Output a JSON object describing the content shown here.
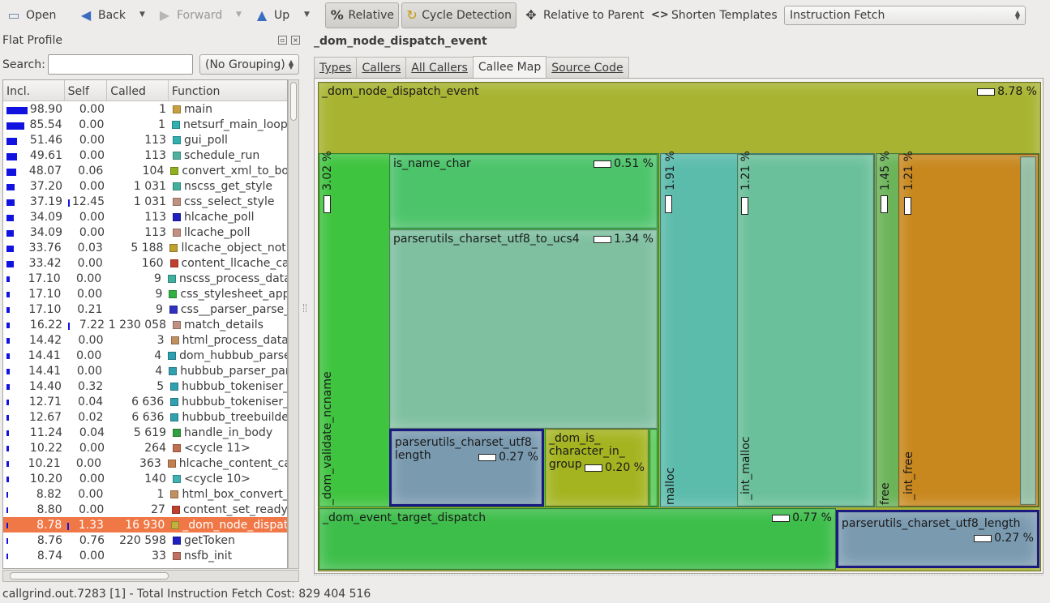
{
  "toolbar": {
    "open": "Open",
    "back": "Back",
    "forward": "Forward",
    "up": "Up",
    "relative": "Relative",
    "cycle": "Cycle Detection",
    "relparent": "Relative to Parent",
    "shorten": "Shorten Templates",
    "eventtype": "Instruction Fetch",
    "icons": {
      "open": "folder-icon",
      "back": "arrow-left-icon",
      "forward": "arrow-right-icon",
      "up": "arrow-up-icon",
      "relative": "percent-icon",
      "cycle": "cycle-icon",
      "relparent": "move-icon",
      "shorten": "angle-brackets-icon"
    }
  },
  "flat": {
    "title": "Flat Profile",
    "search_label": "Search:",
    "search_value": "",
    "grouping": "(No Grouping)",
    "columns": [
      "Incl.",
      "Self",
      "Called",
      "Function"
    ],
    "rows": [
      {
        "incl": "98.90",
        "self": "0.00",
        "called": "1",
        "fn": "main",
        "color": "#c8a040"
      },
      {
        "incl": "85.54",
        "self": "0.00",
        "called": "1",
        "fn": "netsurf_main_loop",
        "color": "#30b0b0"
      },
      {
        "incl": "51.46",
        "self": "0.00",
        "called": "113",
        "fn": "gui_poll",
        "color": "#30b0b0"
      },
      {
        "incl": "49.61",
        "self": "0.00",
        "called": "113",
        "fn": "schedule_run",
        "color": "#50b0a0"
      },
      {
        "incl": "48.07",
        "self": "0.06",
        "called": "104",
        "fn": "convert_xml_to_bo",
        "color": "#90b020"
      },
      {
        "incl": "37.20",
        "self": "0.00",
        "called": "1 031",
        "fn": "nscss_get_style",
        "color": "#40b0a0"
      },
      {
        "incl": "37.19",
        "self": "12.45",
        "called": "1 031",
        "fn": "css_select_style",
        "color": "#c09080"
      },
      {
        "incl": "34.09",
        "self": "0.00",
        "called": "113",
        "fn": "hlcache_poll",
        "color": "#2020c0"
      },
      {
        "incl": "34.09",
        "self": "0.00",
        "called": "113",
        "fn": "llcache_poll",
        "color": "#c09080"
      },
      {
        "incl": "33.76",
        "self": "0.03",
        "called": "5 188",
        "fn": "llcache_object_noti",
        "color": "#c0a030"
      },
      {
        "incl": "33.42",
        "self": "0.00",
        "called": "160",
        "fn": "content_llcache_ca",
        "color": "#c04030"
      },
      {
        "incl": "17.10",
        "self": "0.00",
        "called": "9",
        "fn": "nscss_process_data",
        "color": "#40b0a0"
      },
      {
        "incl": "17.10",
        "self": "0.00",
        "called": "9",
        "fn": "css_stylesheet_app",
        "color": "#30b040"
      },
      {
        "incl": "17.10",
        "self": "0.21",
        "called": "9",
        "fn": "css__parser_parse_",
        "color": "#3030c0"
      },
      {
        "incl": "16.22",
        "self": "7.22",
        "called": "1 230 058",
        "fn": "match_details",
        "color": "#c09080"
      },
      {
        "incl": "14.42",
        "self": "0.00",
        "called": "3",
        "fn": "html_process_data",
        "color": "#c09060"
      },
      {
        "incl": "14.41",
        "self": "0.00",
        "called": "4",
        "fn": "dom_hubbub_parse",
        "color": "#30a0b0"
      },
      {
        "incl": "14.41",
        "self": "0.00",
        "called": "4",
        "fn": "hubbub_parser_par",
        "color": "#30a0b0"
      },
      {
        "incl": "14.40",
        "self": "0.32",
        "called": "5",
        "fn": "hubbub_tokeniser_",
        "color": "#30a0b0"
      },
      {
        "incl": "12.71",
        "self": "0.04",
        "called": "6 636",
        "fn": "hubbub_tokeniser_",
        "color": "#30a0b0"
      },
      {
        "incl": "12.67",
        "self": "0.02",
        "called": "6 636",
        "fn": "hubbub_treebuilde",
        "color": "#30a0b0"
      },
      {
        "incl": "11.24",
        "self": "0.04",
        "called": "5 619",
        "fn": "handle_in_body",
        "color": "#30a040"
      },
      {
        "incl": "10.22",
        "self": "0.00",
        "called": "264",
        "fn": "<cycle 11>",
        "color": "#c07050"
      },
      {
        "incl": "10.21",
        "self": "0.00",
        "called": "363",
        "fn": "hlcache_content_ca",
        "color": "#c08050"
      },
      {
        "incl": "10.20",
        "self": "0.00",
        "called": "140",
        "fn": "<cycle 10>",
        "color": "#40b0b0"
      },
      {
        "incl": "8.82",
        "self": "0.00",
        "called": "1",
        "fn": "html_box_convert_",
        "color": "#c09060"
      },
      {
        "incl": "8.80",
        "self": "0.00",
        "called": "27",
        "fn": "content_set_ready",
        "color": "#c04030"
      },
      {
        "incl": "8.78",
        "self": "1.33",
        "called": "16 930",
        "fn": "_dom_node_dispat",
        "color": "#c0b040"
      },
      {
        "incl": "8.76",
        "self": "0.76",
        "called": "220 598",
        "fn": "getToken",
        "color": "#2020c0"
      },
      {
        "incl": "8.74",
        "self": "0.00",
        "called": "33",
        "fn": "nsfb_init",
        "color": "#c07060"
      }
    ]
  },
  "right": {
    "title": "_dom_node_dispatch_event",
    "tabs": [
      "Types",
      "Callers",
      "All Callers",
      "Callee Map",
      "Source Code"
    ],
    "active_tab": "Callee Map"
  },
  "map": {
    "root": {
      "label": "_dom_node_dispatch_event",
      "pct": "8.78 %"
    },
    "validate": {
      "label": "_dom_validate_ncname",
      "pct": "3.02 %"
    },
    "namechar": {
      "label": "is_name_char",
      "pct": "0.51 %"
    },
    "ucs4": {
      "label": "parserutils_charset_utf8_to_ucs4",
      "pct": "1.34 %"
    },
    "utf8len1": {
      "label1": "parserutils_charset_utf8_",
      "label2": "length",
      "pct": "0.27 %"
    },
    "ischar": {
      "label1": "_dom_is_",
      "label2": "character_in_",
      "label3": "group",
      "pct": "0.20 %"
    },
    "malloc": {
      "label": "malloc",
      "pct": "1.91 %"
    },
    "intmalloc": {
      "label": "_int_malloc",
      "pct": "1.21 %"
    },
    "free": {
      "label": "free",
      "pct": "1.45 %"
    },
    "intfree": {
      "label": "_int_free",
      "pct": "1.21 %"
    },
    "target": {
      "label": "_dom_event_target_dispatch",
      "pct": "0.77 %"
    },
    "utf8len2": {
      "label": "parserutils_charset_utf8_length",
      "pct": "0.27 %"
    }
  },
  "status": "callgrind.out.7283 [1] - Total Instruction Fetch Cost: 829 404 516"
}
